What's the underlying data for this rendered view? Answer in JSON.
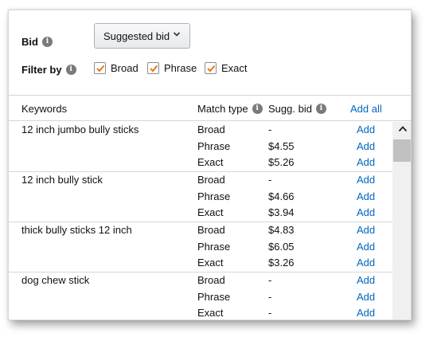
{
  "bid": {
    "label": "Bid",
    "info_icon": "info-icon",
    "select_value": "Suggested bid",
    "select_icon": "chevron-down-icon"
  },
  "filter": {
    "label": "Filter by",
    "options": [
      {
        "label": "Broad",
        "checked": true
      },
      {
        "label": "Phrase",
        "checked": true
      },
      {
        "label": "Exact",
        "checked": true
      }
    ]
  },
  "table": {
    "headers": {
      "keywords": "Keywords",
      "match_type": "Match type",
      "sugg_bid": "Sugg. bid",
      "add_all": "Add all"
    },
    "groups": [
      {
        "keyword": "12 inch jumbo bully sticks",
        "rows": [
          {
            "match": "Broad",
            "bid": "-",
            "action": "Add"
          },
          {
            "match": "Phrase",
            "bid": "$4.55",
            "action": "Add"
          },
          {
            "match": "Exact",
            "bid": "$5.26",
            "action": "Add"
          }
        ]
      },
      {
        "keyword": "12 inch bully stick",
        "rows": [
          {
            "match": "Broad",
            "bid": "-",
            "action": "Add"
          },
          {
            "match": "Phrase",
            "bid": "$4.66",
            "action": "Add"
          },
          {
            "match": "Exact",
            "bid": "$3.94",
            "action": "Add"
          }
        ]
      },
      {
        "keyword": "thick bully sticks 12 inch",
        "rows": [
          {
            "match": "Broad",
            "bid": "$4.83",
            "action": "Add"
          },
          {
            "match": "Phrase",
            "bid": "$6.05",
            "action": "Add"
          },
          {
            "match": "Exact",
            "bid": "$3.26",
            "action": "Add"
          }
        ]
      },
      {
        "keyword": "dog chew stick",
        "rows": [
          {
            "match": "Broad",
            "bid": "-",
            "action": "Add"
          },
          {
            "match": "Phrase",
            "bid": "-",
            "action": "Add"
          },
          {
            "match": "Exact",
            "bid": "-",
            "action": "Add"
          }
        ]
      }
    ]
  },
  "colors": {
    "link": "#0066c0",
    "checkbox_check": "#e47911"
  }
}
